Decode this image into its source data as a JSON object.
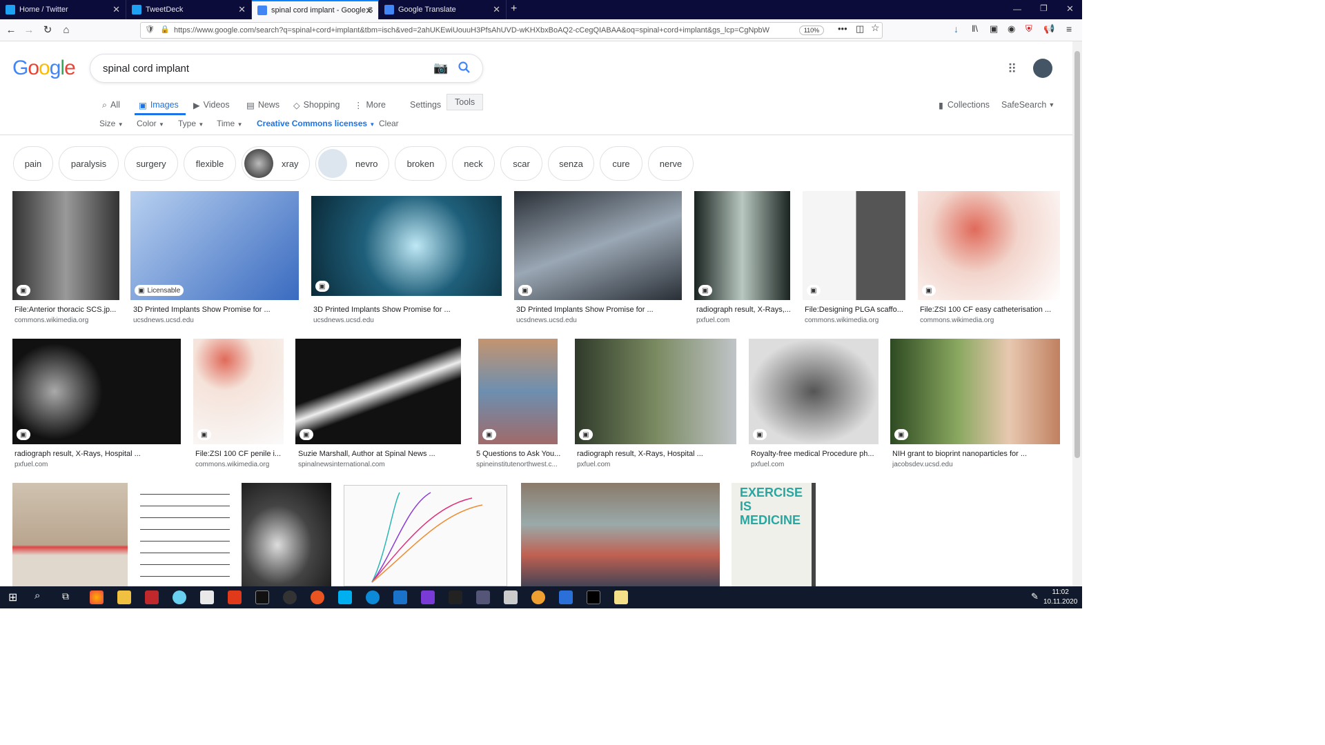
{
  "tabs": [
    {
      "title": "Home / Twitter",
      "fav": "#1da1f2"
    },
    {
      "title": "TweetDeck",
      "fav": "#1da1f2"
    },
    {
      "title": "spinal cord implant - Google S",
      "fav": "#4285f4"
    },
    {
      "title": "Google Translate",
      "fav": "#4285f4"
    }
  ],
  "url": "https://www.google.com/search?q=spinal+cord+implant&tbm=isch&ved=2ahUKEwiUouuH3PfsAhUVD-wKHXbxBoAQ2-cCegQIABAA&oq=spinal+cord+implant&gs_lcp=CgNpbW",
  "zoom": "110%",
  "logo": "Google",
  "query": "spinal cord implant",
  "nav": {
    "all": "All",
    "images": "Images",
    "videos": "Videos",
    "news": "News",
    "shopping": "Shopping",
    "more": "More",
    "settings": "Settings",
    "tools": "Tools",
    "collections": "Collections",
    "safesearch": "SafeSearch"
  },
  "tools": {
    "size": "Size",
    "color": "Color",
    "type": "Type",
    "time": "Time",
    "license": "Creative Commons licenses",
    "clear": "Clear"
  },
  "chips": [
    "pain",
    "paralysis",
    "surgery",
    "flexible",
    "xray",
    "nevro",
    "broken",
    "neck",
    "scar",
    "senza",
    "cure",
    "nerve"
  ],
  "licensable": "Licensable",
  "results": [
    {
      "cap": "File:Anterior thoracic SCS.jp...",
      "src": "commons.wikimedia.org",
      "color": "#555"
    },
    {
      "cap": "3D Printed Implants Show Promise for ...",
      "src": "ucsdnews.ucsd.edu",
      "color": "#5a7ec8"
    },
    {
      "cap": "3D Printed Implants Show Promise for ...",
      "src": "ucsdnews.ucsd.edu",
      "color": "#1f5f7a"
    },
    {
      "cap": "3D Printed Implants Show Promise for ...",
      "src": "ucsdnews.ucsd.edu",
      "color": "#3e4a57"
    },
    {
      "cap": "radiograph result, X-Rays,...",
      "src": "pxfuel.com",
      "color": "#2b3a33"
    },
    {
      "cap": "File:Designing PLGA scaffo...",
      "src": "commons.wikimedia.org",
      "color": "#cfcfcf"
    },
    {
      "cap": "File:ZSI 100 CF easy catheterisation ...",
      "src": "commons.wikimedia.org",
      "color": "#f2d5cc"
    },
    {
      "cap": "radiograph result, X-Rays, Hospital ...",
      "src": "pxfuel.com",
      "color": "#111"
    },
    {
      "cap": "File:ZSI 100 CF penile i...",
      "src": "commons.wikimedia.org",
      "color": "#f5e3da"
    },
    {
      "cap": "Suzie Marshall, Author at Spinal News ...",
      "src": "spinalnewsinternational.com",
      "color": "#1c1c1c"
    },
    {
      "cap": "5 Questions to Ask You...",
      "src": "spineinstitutenorthwest.c...",
      "color": "#a57a5a"
    },
    {
      "cap": "radiograph result, X-Rays, Hospital ...",
      "src": "pxfuel.com",
      "color": "#3d4a33"
    },
    {
      "cap": "Royalty-free medical Procedure ph...",
      "src": "pxfuel.com",
      "color": "#6a6a6a"
    },
    {
      "cap": "NIH grant to bioprint nanoparticles for ...",
      "src": "jacobsdev.ucsd.edu",
      "color": "#5a7a3a"
    }
  ],
  "row3": [
    {
      "color": "#b9a58f"
    },
    {
      "color": "#f5f5f5"
    },
    {
      "color": "#888"
    },
    {
      "color": "#fafafa"
    },
    {
      "color": "#8a7a6a"
    },
    {
      "color": "#f0f0ea"
    }
  ],
  "clock": {
    "time": "11:02",
    "date": "10.11.2020"
  }
}
